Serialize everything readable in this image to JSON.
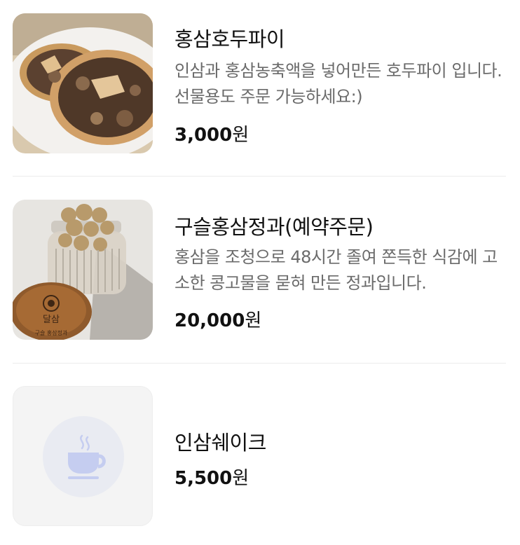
{
  "menu": {
    "items": [
      {
        "name": "홍삼호두파이",
        "description": "인삼과 홍삼농축액을 넣어만든 호두파이 입니다. 선물용도 주문 가능하세요:)",
        "price": "3,000",
        "currency": "원",
        "image": "walnut-pie-photo"
      },
      {
        "name": "구슬홍삼정과(예약주문)",
        "description": "홍삼을 조청으로 48시간 졸여 쫀득한 식감에 고소한 콩고물을 묻혀 만든 정과입니다.",
        "price": "20,000",
        "currency": "원",
        "image": "red-ginseng-jar-photo",
        "jar_lid_text": "달삼",
        "jar_lid_subtext": "구슬 홍삼정과"
      },
      {
        "name": "인삼쉐이크",
        "price": "5,500",
        "currency": "원",
        "image": "coffee-cup-icon"
      }
    ]
  },
  "colors": {
    "text": "#111111",
    "description": "#6b6b6b",
    "divider": "#ececec",
    "placeholder_bg": "#f4f4f4",
    "placeholder_circle": "#e9ebf2",
    "cup_icon": "#c5cdf0"
  }
}
